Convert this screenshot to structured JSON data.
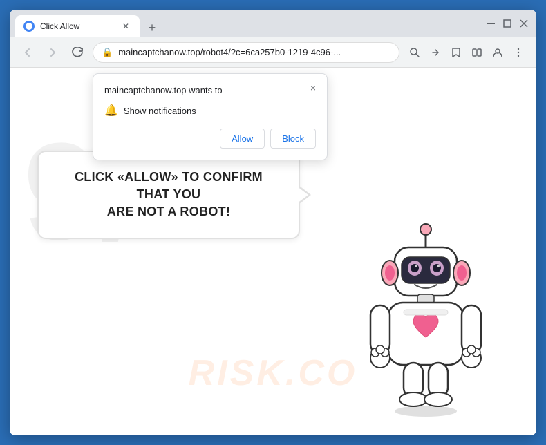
{
  "browser": {
    "tab": {
      "title": "Click Allow",
      "favicon_label": "favicon"
    },
    "window_controls": {
      "minimize": "—",
      "maximize": "□",
      "close": "✕"
    },
    "nav": {
      "back_title": "Back",
      "forward_title": "Forward",
      "refresh_title": "Refresh",
      "url": "maincaptchanow.top/robot4/?c=6ca257b0-1219-4c96-...",
      "url_full": "maincaptchanow.top/robot4/?c=6ca257b0-1219-4c96-..."
    },
    "new_tab_label": "+"
  },
  "popup": {
    "title": "maincaptchanow.top wants to",
    "notification_label": "Show notifications",
    "allow_btn": "Allow",
    "block_btn": "Block",
    "close_label": "×"
  },
  "page": {
    "bubble_text_line1": "CLICK «ALLOW» TO CONFIRM THAT YOU",
    "bubble_text_line2": "ARE NOT A ROBOT!",
    "watermark_main": "9/7",
    "watermark_sub": "RISK.CO"
  },
  "colors": {
    "border": "#2a6db5",
    "accent": "#1a73e8",
    "allow_btn_color": "#1a73e8",
    "block_btn_color": "#1a73e8"
  }
}
